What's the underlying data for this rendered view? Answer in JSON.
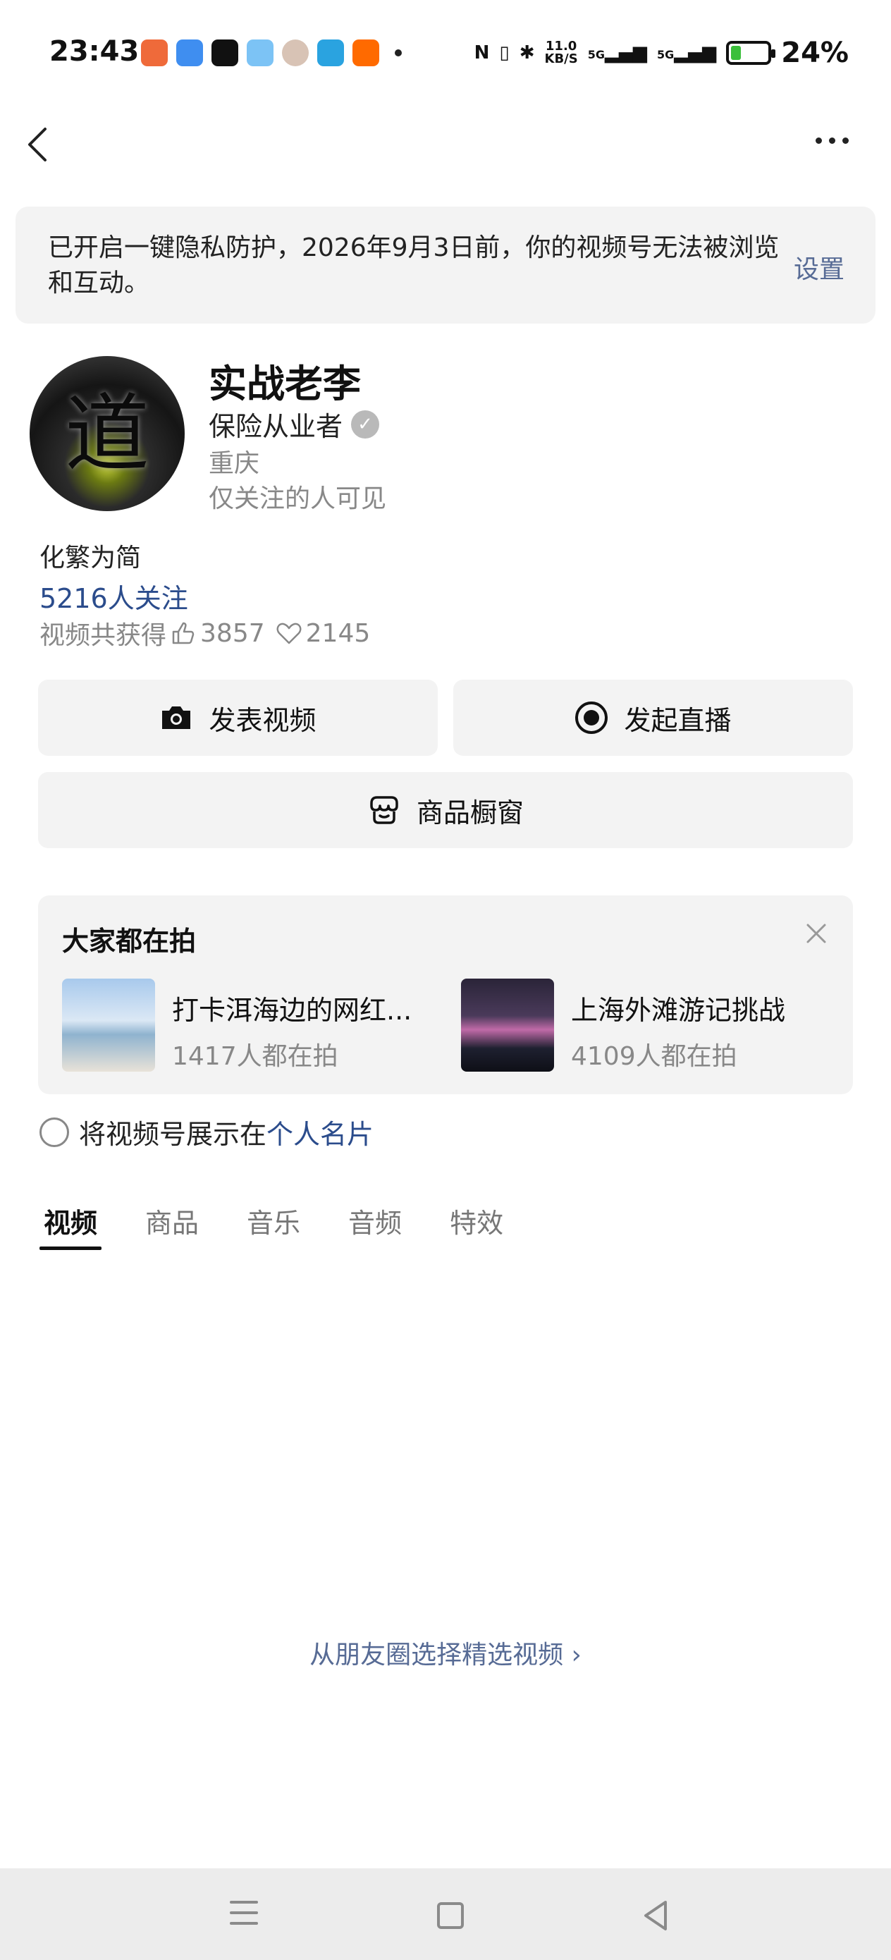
{
  "status_bar": {
    "time": "23:43",
    "net_speed": "11.0\nKB/S",
    "signal_1": "5G",
    "signal_2": "5G",
    "battery": "24%"
  },
  "notice": {
    "text": "已开启一键隐私防护，2026年9月3日前，你的视频号无法被浏览和互动。",
    "link": "设置"
  },
  "profile": {
    "avatar_char": "道",
    "name": "实战老李",
    "title": "保险从业者",
    "location": "重庆",
    "visibility": "仅关注的人可见",
    "bio": "化繁为简",
    "followers": "5216人关注",
    "likes_prefix": "视频共获得",
    "likes": "3857",
    "hearts": "2145"
  },
  "actions": {
    "post_video": "发表视频",
    "start_live": "发起直播",
    "shop_window": "商品橱窗"
  },
  "trending": {
    "title": "大家都在拍",
    "items": [
      {
        "name": "打卡洱海边的网红...",
        "count": "1417人都在拍"
      },
      {
        "name": "上海外滩游记挑战",
        "count": "4109人都在拍"
      }
    ]
  },
  "card_option": {
    "prefix": "将视频号展示在",
    "link": "个人名片"
  },
  "tabs": [
    {
      "label": "视频"
    },
    {
      "label": "商品"
    },
    {
      "label": "音乐"
    },
    {
      "label": "音频"
    },
    {
      "label": "特效"
    }
  ],
  "moments_link": "从朋友圈选择精选视频 ›"
}
